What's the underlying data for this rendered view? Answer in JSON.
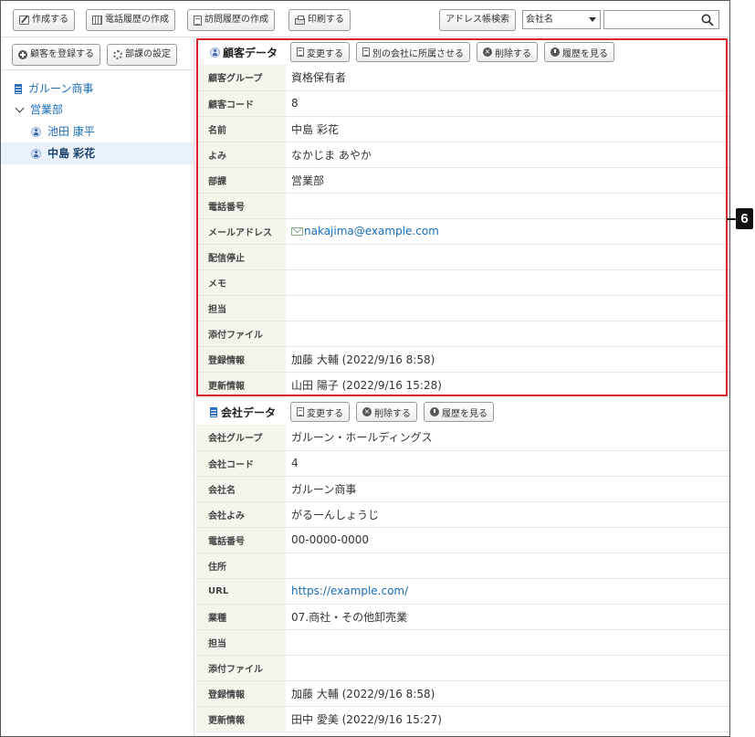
{
  "toolbar": {
    "create": "作成する",
    "phone_history": "電話履歴の作成",
    "visit_history": "訪問履歴の作成",
    "print": "印刷する",
    "address_search": "アドレス帳検索",
    "search_field_select": "会社名",
    "search_placeholder": ""
  },
  "left": {
    "register_customer": "顧客を登録する",
    "department_settings": "部課の設定",
    "tree": {
      "company": "ガルーン商事",
      "department": "営業部",
      "people": [
        "池田 康平",
        "中島 彩花"
      ],
      "selected_index": 1
    }
  },
  "customer": {
    "title": "顧客データ",
    "buttons": {
      "edit": "変更する",
      "move": "別の会社に所属させる",
      "delete": "削除する",
      "history": "履歴を見る"
    },
    "rows": [
      {
        "label": "顧客グループ",
        "value": "資格保有者"
      },
      {
        "label": "顧客コード",
        "value": "8"
      },
      {
        "label": "名前",
        "value": "中島 彩花"
      },
      {
        "label": "よみ",
        "value": "なかじま あやか"
      },
      {
        "label": "部課",
        "value": "営業部"
      },
      {
        "label": "電話番号",
        "value": ""
      },
      {
        "label": "メールアドレス",
        "value": "nakajima@example.com"
      },
      {
        "label": "配信停止",
        "value": ""
      },
      {
        "label": "メモ",
        "value": ""
      },
      {
        "label": "担当",
        "value": ""
      },
      {
        "label": "添付ファイル",
        "value": ""
      },
      {
        "label": "登録情報",
        "value": "加藤 大輔 (2022/9/16 8:58)"
      },
      {
        "label": "更新情報",
        "value": "山田 陽子 (2022/9/16 15:28)"
      }
    ]
  },
  "company": {
    "title": "会社データ",
    "buttons": {
      "edit": "変更する",
      "delete": "削除する",
      "history": "履歴を見る"
    },
    "rows": [
      {
        "label": "会社グループ",
        "value": "ガルーン・ホールディングス"
      },
      {
        "label": "会社コード",
        "value": "4"
      },
      {
        "label": "会社名",
        "value": "ガルーン商事"
      },
      {
        "label": "会社よみ",
        "value": "がるーんしょうじ"
      },
      {
        "label": "電話番号",
        "value": "00-0000-0000"
      },
      {
        "label": "住所",
        "value": ""
      },
      {
        "label": "URL",
        "value": "https://example.com/"
      },
      {
        "label": "業種",
        "value": "07.商社・その他卸売業"
      },
      {
        "label": "担当",
        "value": ""
      },
      {
        "label": "添付ファイル",
        "value": ""
      },
      {
        "label": "登録情報",
        "value": "加藤 大輔 (2022/9/16 8:58)"
      },
      {
        "label": "更新情報",
        "value": "田中 愛美 (2022/9/16 15:27)"
      }
    ]
  },
  "annotation": {
    "callout_number": "6",
    "highlight_color": "#d8232a"
  }
}
